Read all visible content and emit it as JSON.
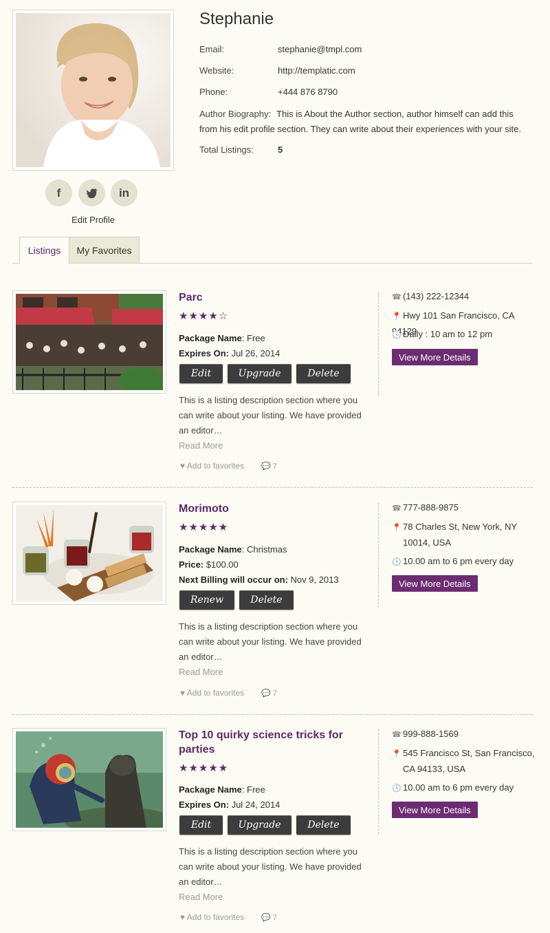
{
  "profile": {
    "name": "Stephanie",
    "email_label": "Email:",
    "email": "stephanie@tmpl.com",
    "website_label": "Website:",
    "website": "http://templatic.com",
    "phone_label": "Phone:",
    "phone": "+444 876 8790",
    "bio_label": "Author Biography:",
    "bio": "This is About the Author section, author himself can add this from his edit profile section. They can write about their experiences with your site.",
    "total_label": "Total Listings:",
    "total": "5",
    "edit_label": "Edit Profile",
    "social": [
      {
        "icon": "facebook-icon",
        "glyph": "f"
      },
      {
        "icon": "twitter-icon",
        "glyph": "🐦"
      },
      {
        "icon": "linkedin-icon",
        "glyph": "in"
      }
    ]
  },
  "tabs": [
    {
      "label": "Listings",
      "active": true
    },
    {
      "label": "My Favorites",
      "active": false
    }
  ],
  "listings": [
    {
      "title": "Parc",
      "rating": 4,
      "meta": [
        {
          "k": "Package Name",
          "v": ": Free"
        },
        {
          "k": "Expires On:",
          "v": " Jul 26, 2014"
        }
      ],
      "buttons": [
        "Edit",
        "Upgrade",
        "Delete"
      ],
      "description": "This is a listing description section where you can write about your listing. We have provided an editor…",
      "read_more": "Read More",
      "favorites": "Add to favorites",
      "comments": "7",
      "phone": "(143) 222-12344",
      "address": "Hwy 101 San Francisco, CA 94129",
      "hours": "Daily : 10 am to 12 pm",
      "details_label": "View More Details"
    },
    {
      "title": "Morimoto",
      "rating": 5,
      "meta": [
        {
          "k": "Package Name",
          "v": ": Christmas"
        },
        {
          "k": "Price:",
          "v": " $100.00"
        },
        {
          "k": "Next Billing will occur on:",
          "v": " Nov 9, 2013"
        }
      ],
      "buttons": [
        "Renew",
        "Delete"
      ],
      "description": "This is a listing description section where you can write about your listing. We have provided an editor…",
      "read_more": "Read More",
      "favorites": "Add to favorites",
      "comments": "7",
      "phone": "777-888-9875",
      "address": "78 Charles St, New York, NY 10014, USA",
      "hours": "10.00 am to 6 pm every day",
      "details_label": "View More Details"
    },
    {
      "title": "Top 10 quirky science tricks for parties",
      "rating": 5,
      "meta": [
        {
          "k": "Package Name",
          "v": ": Free"
        },
        {
          "k": "Expires On:",
          "v": " Jul 24, 2014"
        }
      ],
      "buttons": [
        "Edit",
        "Upgrade",
        "Delete"
      ],
      "description": "This is a listing description section where you can write about your listing. We have provided an editor…",
      "read_more": "Read More",
      "favorites": "Add to favorites",
      "comments": "7",
      "phone": "999-888-1569",
      "address": "545 Francisco St, San Francisco, CA 94133, USA",
      "hours": "10.00 am to 6 pm every day",
      "details_label": "View More Details"
    }
  ],
  "colors": {
    "accent": "#5c2a66",
    "button": "#3c3c3c",
    "background": "#fcfcf5"
  }
}
